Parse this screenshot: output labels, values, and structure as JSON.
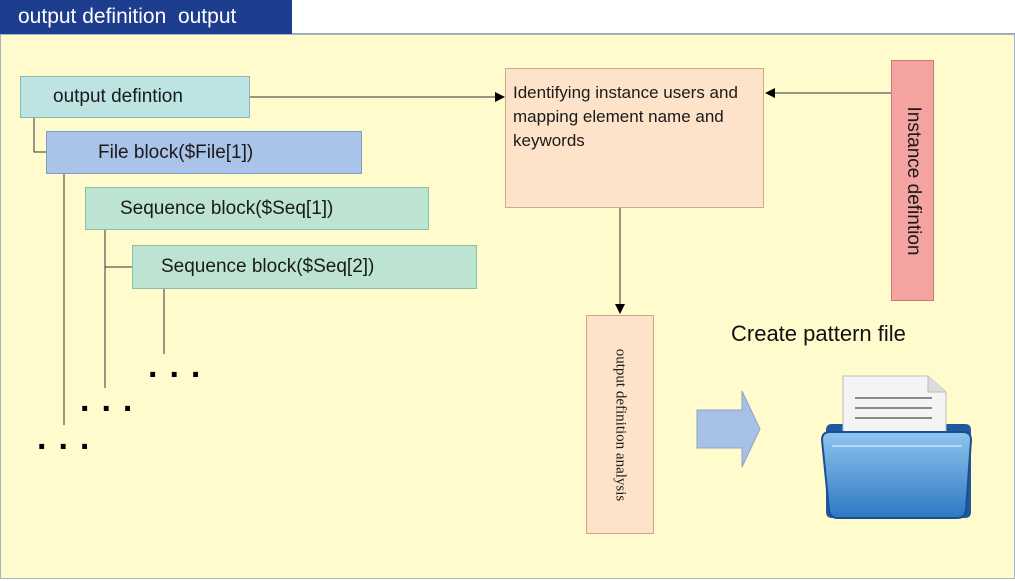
{
  "header": {
    "tab_title": "output definition  output"
  },
  "diagram": {
    "output_definition": "output defintion",
    "file_block": "File block($File[1])",
    "sequence_block_1": "Sequence block($Seq[1])",
    "sequence_block_2": "Sequence block($Seq[2])",
    "identifying": "Identifying instance users and mapping element name and keywords",
    "instance_definition": "Instance defintion",
    "output_analysis": "output definition analysis",
    "create_pattern_file": "Create pattern file",
    "ellipsis": "..."
  },
  "colors": {
    "tab_bg": "#1d3d8f",
    "canvas_bg": "#fffbcc",
    "output_def_box": "#bde4e3",
    "file_block_box": "#a9c4e8",
    "sequence_box": "#bde4d3",
    "identify_box": "#fde3c9",
    "instance_box": "#f4a3a0",
    "arrow_blue": "#a6c0e6"
  }
}
